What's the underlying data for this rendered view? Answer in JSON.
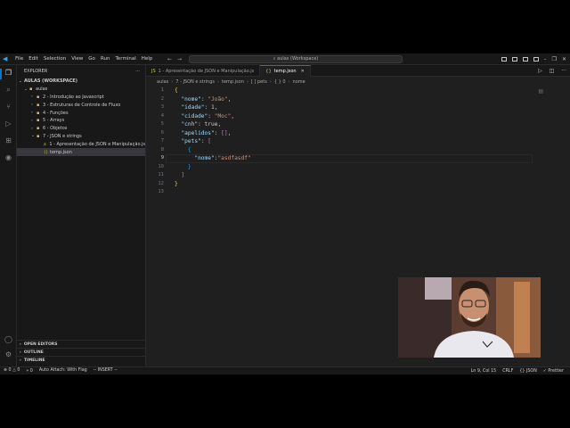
{
  "menu": [
    "File",
    "Edit",
    "Selection",
    "View",
    "Go",
    "Run",
    "Terminal",
    "Help"
  ],
  "command_center": "aulas (Workspace)",
  "explorer": {
    "title": "EXPLORER",
    "workspace": "AULAS (WORKSPACE)",
    "tree": [
      {
        "label": "aulas",
        "level": 0,
        "expanded": true,
        "type": "folder"
      },
      {
        "label": "2 - Introdução ao Javascript",
        "level": 1,
        "expanded": false,
        "type": "folder"
      },
      {
        "label": "3 - Estruturas de Controle de Fluxo",
        "level": 1,
        "expanded": false,
        "type": "folder"
      },
      {
        "label": "4 - Funções",
        "level": 1,
        "expanded": false,
        "type": "folder"
      },
      {
        "label": "5 - Arrays",
        "level": 1,
        "expanded": false,
        "type": "folder"
      },
      {
        "label": "6 - Objetos",
        "level": 1,
        "expanded": false,
        "type": "folder"
      },
      {
        "label": "7 - JSON e strings",
        "level": 1,
        "expanded": true,
        "type": "folder"
      },
      {
        "label": "1 - Apresentação de JSON e Manipulação.js",
        "level": 2,
        "type": "js"
      },
      {
        "label": "temp.json",
        "level": 2,
        "type": "json",
        "selected": true
      }
    ],
    "footer": [
      "OPEN EDITORS",
      "OUTLINE",
      "TIMELINE"
    ]
  },
  "tabs": [
    {
      "label": "1 - Apresentação de JSON e Manipulação.js",
      "icon": "JS",
      "active": false
    },
    {
      "label": "temp.json",
      "icon": "{}",
      "active": true
    }
  ],
  "breadcrumb": [
    "aulas",
    "7 - JSON e strings",
    "temp.json",
    "[ ] pets",
    "{ } 0",
    "nome"
  ],
  "code_lines": [
    {
      "n": "1",
      "tokens": [
        [
          "b",
          "{"
        ]
      ]
    },
    {
      "n": "2",
      "tokens": [
        [
          "t",
          "  "
        ],
        [
          "k",
          "\"nome\""
        ],
        [
          "t",
          ": "
        ],
        [
          "s",
          "\"João\""
        ],
        [
          "t",
          ","
        ]
      ]
    },
    {
      "n": "3",
      "tokens": [
        [
          "t",
          "  "
        ],
        [
          "k",
          "\"idade\""
        ],
        [
          "t",
          ": 1,"
        ]
      ]
    },
    {
      "n": "4",
      "tokens": [
        [
          "t",
          "  "
        ],
        [
          "k",
          "\"cidade\""
        ],
        [
          "t",
          ": "
        ],
        [
          "s",
          "\"Moc\""
        ],
        [
          "t",
          ","
        ]
      ]
    },
    {
      "n": "5",
      "tokens": [
        [
          "t",
          "  "
        ],
        [
          "k",
          "\"cnh\""
        ],
        [
          "t",
          ": true,"
        ]
      ]
    },
    {
      "n": "6",
      "tokens": [
        [
          "t",
          "  "
        ],
        [
          "k",
          "\"apelidos\""
        ],
        [
          "t",
          ": "
        ],
        [
          "p",
          "[]"
        ],
        [
          "t",
          ","
        ]
      ]
    },
    {
      "n": "7",
      "tokens": [
        [
          "t",
          "  "
        ],
        [
          "k",
          "\"pets\""
        ],
        [
          "t",
          ": "
        ],
        [
          "p",
          "["
        ]
      ]
    },
    {
      "n": "8",
      "tokens": [
        [
          "t",
          "    "
        ],
        [
          "bl",
          "{"
        ]
      ]
    },
    {
      "n": "9",
      "tokens": [
        [
          "t",
          "      "
        ],
        [
          "k",
          "\"nome\""
        ],
        [
          "t",
          ":"
        ],
        [
          "s",
          "\"asdfasdf\""
        ]
      ]
    },
    {
      "n": "10",
      "tokens": [
        [
          "t",
          "    "
        ],
        [
          "bl",
          "}"
        ]
      ]
    },
    {
      "n": "11",
      "tokens": [
        [
          "t",
          "  "
        ],
        [
          "p",
          "]"
        ]
      ]
    },
    {
      "n": "12",
      "tokens": [
        [
          "b",
          "}"
        ]
      ]
    },
    {
      "n": "13",
      "tokens": []
    }
  ],
  "current_line": "9",
  "status": {
    "left": [
      "⊗ 0 △ 0",
      "⑂ 0",
      "Auto Attach: With Flag",
      "-- INSERT --"
    ],
    "right": [
      "Ln 9, Col 15",
      "CRLF",
      "{} JSON",
      "✓ Prettier"
    ]
  },
  "colors": {
    "accent": "#0078d4",
    "bg": "#1f1f1f",
    "sidebar": "#181818"
  }
}
